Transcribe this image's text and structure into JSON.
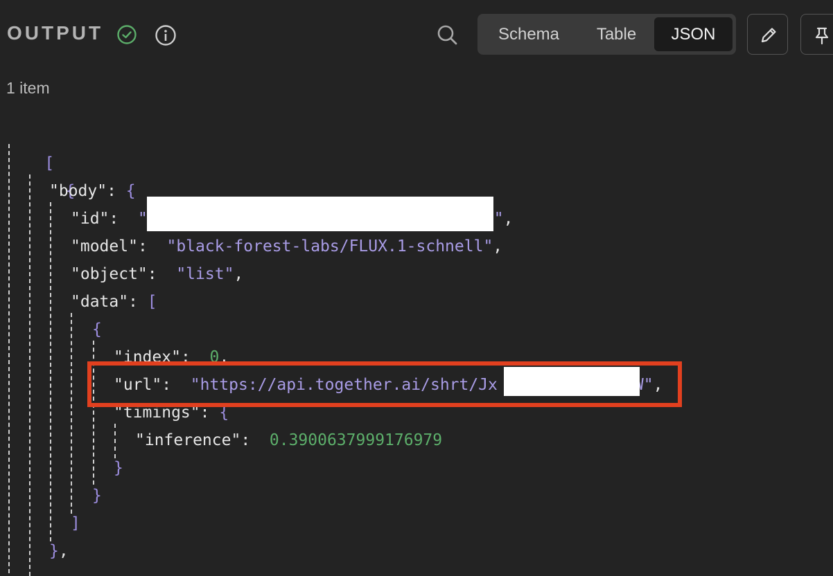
{
  "header": {
    "title": "OUTPUT",
    "tabs": [
      {
        "label": "Schema",
        "active": false
      },
      {
        "label": "Table",
        "active": false
      },
      {
        "label": "JSON",
        "active": true
      }
    ]
  },
  "item_count": "1 item",
  "json": {
    "open_array": "[",
    "open_obj": "{",
    "body_key": "\"body\"",
    "id_key": "\"id\"",
    "id_prefix": "\"",
    "id_suffix": "\"",
    "model_key": "\"model\"",
    "model_value": "\"black-forest-labs/FLUX.1-schnell\"",
    "object_key": "\"object\"",
    "object_value": "\"list\"",
    "data_key": "\"data\"",
    "index_key": "\"index\"",
    "index_value": "0",
    "url_key": "\"url\"",
    "url_prefix": "\"https://api.together.ai/shrt/Jx",
    "url_suffix": "W\"",
    "timings_key": "\"timings\"",
    "inference_key": "\"inference\"",
    "inference_value": "0.3900637999176979"
  },
  "colors": {
    "accent_highlight": "#e2401f",
    "check_green": "#5cae6a",
    "string_purple": "#a99ce6"
  }
}
